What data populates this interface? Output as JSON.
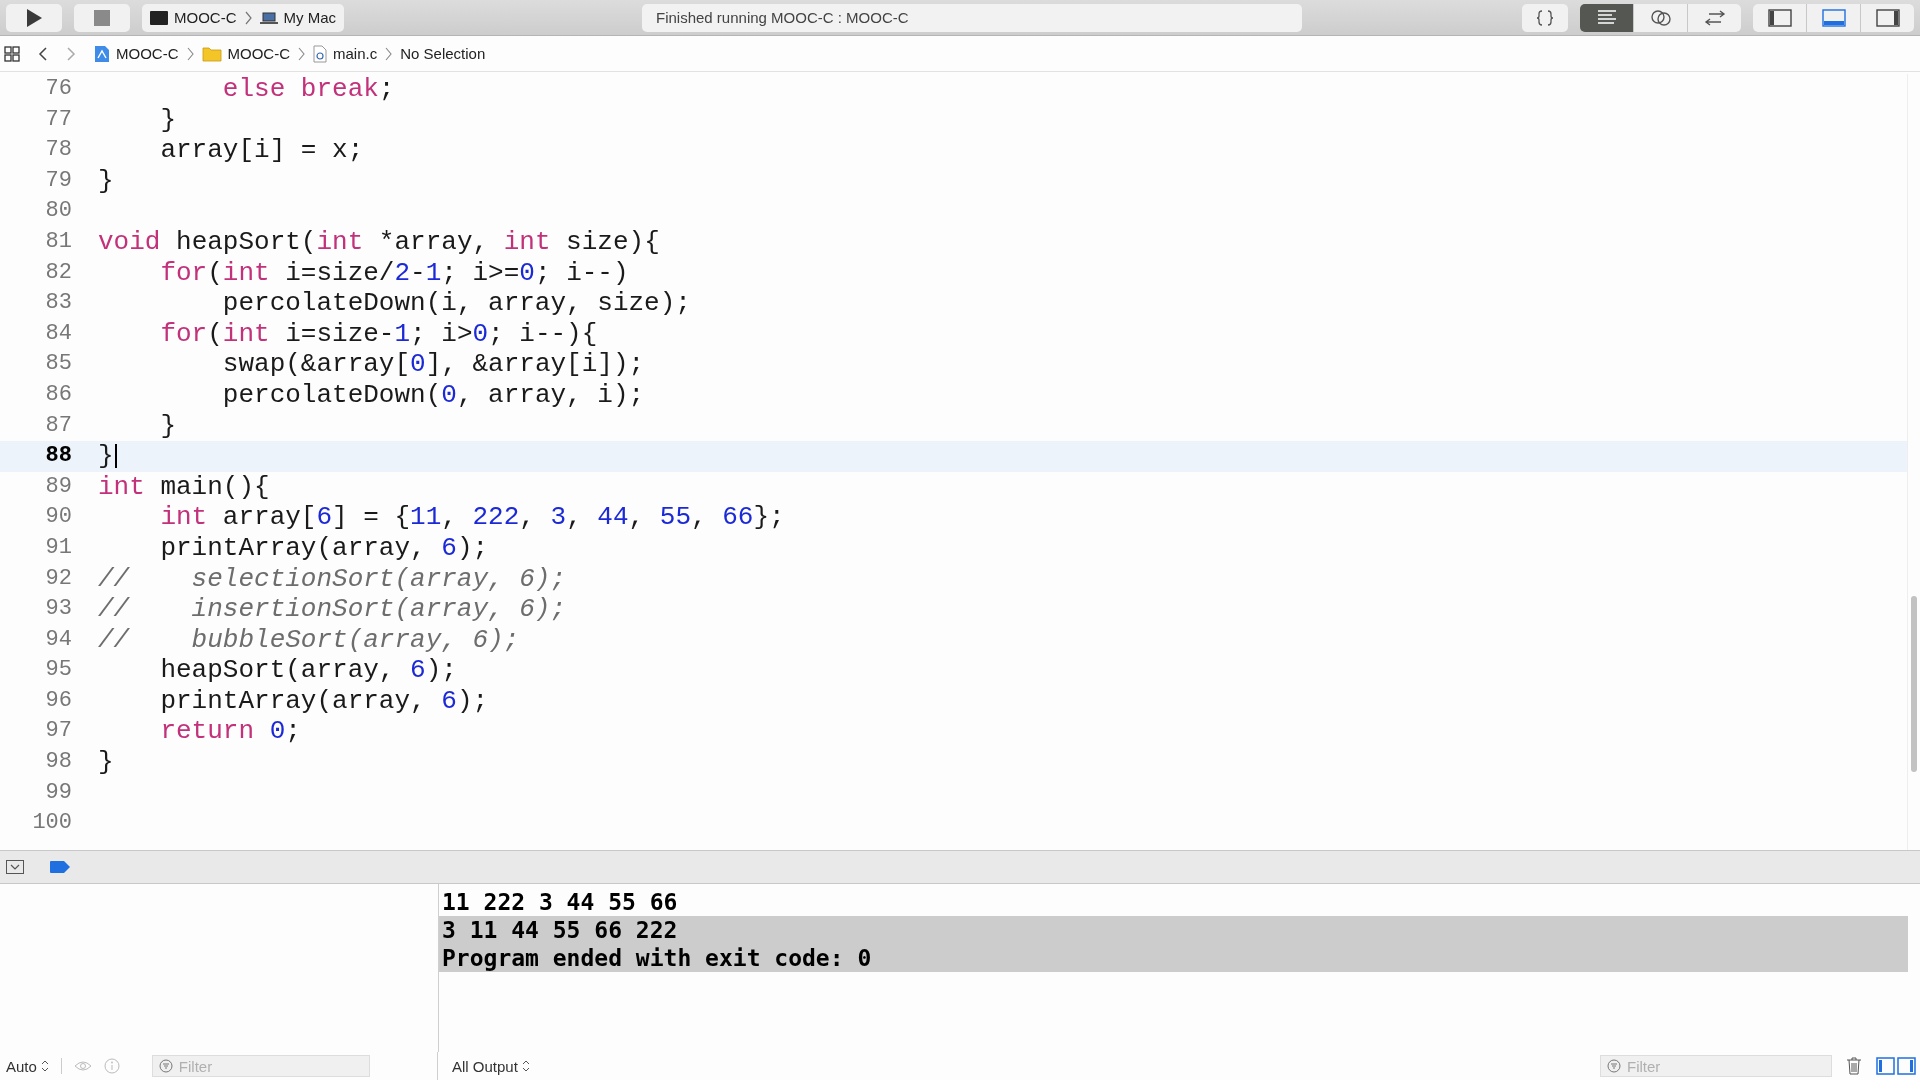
{
  "toolbar": {
    "scheme": {
      "target": "MOOC-C",
      "device": "My Mac"
    },
    "status": "Finished running MOOC-C : MOOC-C",
    "editor_modes": [
      {
        "kind": "standard",
        "selected": true
      },
      {
        "kind": "assistant",
        "selected": false
      },
      {
        "kind": "version",
        "selected": false
      }
    ],
    "panels": [
      {
        "kind": "left",
        "on": false
      },
      {
        "kind": "bottom",
        "on": true
      },
      {
        "kind": "right",
        "on": false
      }
    ]
  },
  "jump_bar": {
    "items": [
      {
        "kind": "project",
        "label": "MOOC-C"
      },
      {
        "kind": "folder",
        "label": "MOOC-C"
      },
      {
        "kind": "file",
        "label": "main.c"
      },
      {
        "kind": "plain",
        "label": "No Selection"
      }
    ]
  },
  "editor": {
    "lines": [
      {
        "number": "76",
        "current": false,
        "tokens": [
          {
            "kind": "keyword",
            "t": "        else break"
          },
          {
            "kind": "plain",
            "t": ";"
          }
        ]
      },
      {
        "number": "77",
        "current": false,
        "tokens": [
          {
            "kind": "plain",
            "t": "    }"
          }
        ]
      },
      {
        "number": "78",
        "current": false,
        "tokens": [
          {
            "kind": "plain",
            "t": "    array[i] = x;"
          }
        ]
      },
      {
        "number": "79",
        "current": false,
        "tokens": [
          {
            "kind": "plain",
            "t": "}"
          }
        ]
      },
      {
        "number": "80",
        "current": false
      },
      {
        "number": "81",
        "current": false,
        "tokens": [
          {
            "kind": "keyword",
            "t": "void"
          },
          {
            "kind": "plain",
            "t": " heapSort("
          },
          {
            "kind": "keyword",
            "t": "int"
          },
          {
            "kind": "plain",
            "t": " *array, "
          },
          {
            "kind": "keyword",
            "t": "int"
          },
          {
            "kind": "plain",
            "t": " size){"
          }
        ]
      },
      {
        "number": "82",
        "current": false,
        "tokens": [
          {
            "kind": "keyword",
            "t": "    for"
          },
          {
            "kind": "plain",
            "t": "("
          },
          {
            "kind": "keyword",
            "t": "int"
          },
          {
            "kind": "plain",
            "t": " i=size/"
          },
          {
            "kind": "number",
            "t": "2"
          },
          {
            "kind": "plain",
            "t": "-"
          },
          {
            "kind": "number",
            "t": "1"
          },
          {
            "kind": "plain",
            "t": "; i>="
          },
          {
            "kind": "number",
            "t": "0"
          },
          {
            "kind": "plain",
            "t": "; i--)"
          }
        ]
      },
      {
        "number": "83",
        "current": false,
        "tokens": [
          {
            "kind": "plain",
            "t": "        percolateDown(i, array, size);"
          }
        ]
      },
      {
        "number": "84",
        "current": false,
        "tokens": [
          {
            "kind": "keyword",
            "t": "    for"
          },
          {
            "kind": "plain",
            "t": "("
          },
          {
            "kind": "keyword",
            "t": "int"
          },
          {
            "kind": "plain",
            "t": " i=size-"
          },
          {
            "kind": "number",
            "t": "1"
          },
          {
            "kind": "plain",
            "t": "; i>"
          },
          {
            "kind": "number",
            "t": "0"
          },
          {
            "kind": "plain",
            "t": "; i--){"
          }
        ]
      },
      {
        "number": "85",
        "current": false,
        "tokens": [
          {
            "kind": "plain",
            "t": "        swap(&array["
          },
          {
            "kind": "number",
            "t": "0"
          },
          {
            "kind": "plain",
            "t": "], &array[i]);"
          }
        ]
      },
      {
        "number": "86",
        "current": false,
        "tokens": [
          {
            "kind": "plain",
            "t": "        percolateDown("
          },
          {
            "kind": "number",
            "t": "0"
          },
          {
            "kind": "plain",
            "t": ", array, i);"
          }
        ]
      },
      {
        "number": "87",
        "current": false,
        "tokens": [
          {
            "kind": "plain",
            "t": "    }"
          }
        ]
      },
      {
        "number": "88",
        "current": true,
        "tokens": [
          {
            "kind": "plain",
            "t": "}"
          }
        ]
      },
      {
        "number": "89",
        "current": false,
        "tokens": [
          {
            "kind": "keyword",
            "t": "int"
          },
          {
            "kind": "plain",
            "t": " main(){"
          }
        ]
      },
      {
        "number": "90",
        "current": false,
        "tokens": [
          {
            "kind": "keyword",
            "t": "    int"
          },
          {
            "kind": "plain",
            "t": " array["
          },
          {
            "kind": "number",
            "t": "6"
          },
          {
            "kind": "plain",
            "t": "] = {"
          },
          {
            "kind": "number",
            "t": "11"
          },
          {
            "kind": "plain",
            "t": ", "
          },
          {
            "kind": "number",
            "t": "222"
          },
          {
            "kind": "plain",
            "t": ", "
          },
          {
            "kind": "number",
            "t": "3"
          },
          {
            "kind": "plain",
            "t": ", "
          },
          {
            "kind": "number",
            "t": "44"
          },
          {
            "kind": "plain",
            "t": ", "
          },
          {
            "kind": "number",
            "t": "55"
          },
          {
            "kind": "plain",
            "t": ", "
          },
          {
            "kind": "number",
            "t": "66"
          },
          {
            "kind": "plain",
            "t": "};"
          }
        ]
      },
      {
        "number": "91",
        "current": false,
        "tokens": [
          {
            "kind": "plain",
            "t": "    printArray(array, "
          },
          {
            "kind": "number",
            "t": "6"
          },
          {
            "kind": "plain",
            "t": ");"
          }
        ]
      },
      {
        "number": "92",
        "current": false,
        "tokens": [
          {
            "kind": "comment",
            "t": "//    selectionSort(array, 6);"
          }
        ]
      },
      {
        "number": "93",
        "current": false,
        "tokens": [
          {
            "kind": "comment",
            "t": "//    insertionSort(array, 6);"
          }
        ]
      },
      {
        "number": "94",
        "current": false,
        "tokens": [
          {
            "kind": "comment",
            "t": "//    bubbleSort(array, 6);"
          }
        ]
      },
      {
        "number": "95",
        "current": false,
        "tokens": [
          {
            "kind": "plain",
            "t": "    heapSort(array, "
          },
          {
            "kind": "number",
            "t": "6"
          },
          {
            "kind": "plain",
            "t": ");"
          }
        ]
      },
      {
        "number": "96",
        "current": false,
        "tokens": [
          {
            "kind": "plain",
            "t": "    printArray(array, "
          },
          {
            "kind": "number",
            "t": "6"
          },
          {
            "kind": "plain",
            "t": ");"
          }
        ]
      },
      {
        "number": "97",
        "current": false,
        "tokens": [
          {
            "kind": "keyword",
            "t": "    return"
          },
          {
            "kind": "number",
            "t": " 0"
          },
          {
            "kind": "plain",
            "t": ";"
          }
        ]
      },
      {
        "number": "98",
        "current": false,
        "tokens": [
          {
            "kind": "plain",
            "t": "}"
          }
        ]
      },
      {
        "number": "99",
        "current": false
      },
      {
        "number": "100",
        "current": false
      }
    ]
  },
  "console": {
    "lines": [
      {
        "text": "11 222 3 44 55 66",
        "selected": false
      },
      {
        "text": "3 11 44 55 66 222",
        "selected": true
      },
      {
        "text": "Program ended with exit code: 0",
        "selected": true
      }
    ]
  },
  "bottom_bar": {
    "variables_scope": "Auto",
    "variables_filter": {
      "placeholder": "Filter"
    },
    "output_scope": "All Output",
    "output_filter": {
      "placeholder": "Filter"
    }
  }
}
